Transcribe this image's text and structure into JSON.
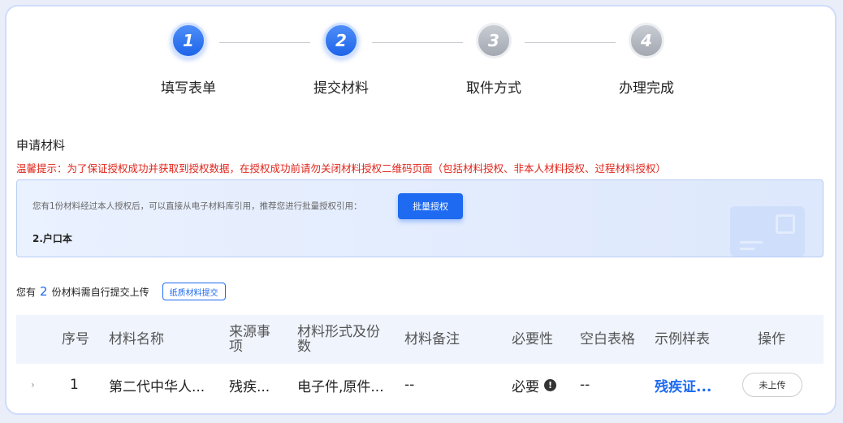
{
  "steps": [
    {
      "number": "1",
      "label": "填写表单",
      "state": "active"
    },
    {
      "number": "2",
      "label": "提交材料",
      "state": "active"
    },
    {
      "number": "3",
      "label": "取件方式",
      "state": "inactive"
    },
    {
      "number": "4",
      "label": "办理完成",
      "state": "inactive"
    }
  ],
  "section": {
    "title": "申请材料",
    "warning": "温馨提示：为了保证授权成功并获取到授权数据，在授权成功前请勿关闭材料授权二维码页面（包括材料授权、非本人材料授权、过程材料授权）"
  },
  "auth": {
    "text": "您有1份材料经过本人授权后，可以直接从电子材料库引用，推荐您进行批量授权引用：",
    "button": "批量授权",
    "item": "2.户口本"
  },
  "self_upload": {
    "prefix": "您有",
    "count": "2",
    "suffix": "份材料需自行提交上传",
    "paper_button": "纸质材料提交"
  },
  "table": {
    "headers": [
      "序号",
      "材料名称",
      "来源事项",
      "材料形式及份数",
      "材料备注",
      "必要性",
      "空白表格",
      "示例样表",
      "操作"
    ],
    "rows": [
      {
        "expand": "›",
        "index": "1",
        "name": "第二代中华人...",
        "source": "残疾...",
        "form": "电子件,原件...",
        "note": "--",
        "necessity": "必要",
        "necessity_icon": "!",
        "blank_form": "--",
        "sample": "残疾证...",
        "action": "未上传"
      }
    ]
  },
  "colors": {
    "accent": "#1e6af1",
    "warning": "#e0251b",
    "inactive_step": "#a3a8b1"
  }
}
